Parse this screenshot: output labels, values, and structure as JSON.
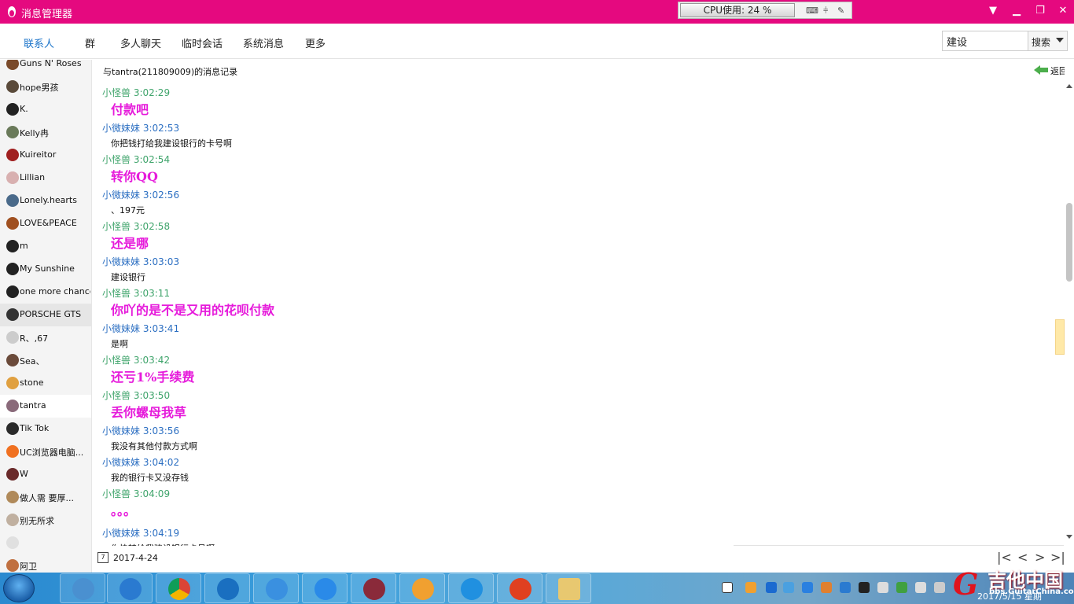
{
  "window": {
    "title": "消息管理器",
    "cpu_usage": "CPU使用: 24 %"
  },
  "tabs": [
    {
      "label": "联系人",
      "active": true
    },
    {
      "label": "群",
      "active": false
    },
    {
      "label": "多人聊天",
      "active": false
    },
    {
      "label": "临时会话",
      "active": false
    },
    {
      "label": "系统消息",
      "active": false
    },
    {
      "label": "更多",
      "active": false
    }
  ],
  "search": {
    "value": "建设",
    "button_label": "搜索"
  },
  "contacts": [
    {
      "name": "Guns N' Roses",
      "avatar_color": "#7a4a2a"
    },
    {
      "name": "hope男孩",
      "avatar_color": "#5a4a3a"
    },
    {
      "name": "K.",
      "avatar_color": "#222222"
    },
    {
      "name": "Kelly冉",
      "avatar_color": "#6a7a5a"
    },
    {
      "name": "Kuireitor",
      "avatar_color": "#a02020"
    },
    {
      "name": "Lillian",
      "avatar_color": "#d8b0b0"
    },
    {
      "name": "Lonely.hearts",
      "avatar_color": "#4a6a8a"
    },
    {
      "name": "LOVE&PEACE",
      "avatar_color": "#a05020"
    },
    {
      "name": "m",
      "avatar_color": "#222222"
    },
    {
      "name": "My  Sunshine",
      "avatar_color": "#222222"
    },
    {
      "name": "one more chance",
      "avatar_color": "#222222"
    },
    {
      "name": "PORSCHE GTS",
      "avatar_color": "#333333"
    },
    {
      "name": "R、,67",
      "avatar_color": "#cccccc"
    },
    {
      "name": "Sea、",
      "avatar_color": "#6a4a3a"
    },
    {
      "name": "stone",
      "avatar_color": "#e0a040"
    },
    {
      "name": "tantra",
      "avatar_color": "#8a6a7a"
    },
    {
      "name": "Tik Tok",
      "avatar_color": "#2a2a2a"
    },
    {
      "name": "UC浏览器电脑...",
      "avatar_color": "#f07020"
    },
    {
      "name": "W",
      "avatar_color": "#6a2a2a"
    },
    {
      "name": "  做人需   要厚...",
      "avatar_color": "#b08a5a"
    },
    {
      "name": "  别无所求",
      "avatar_color": "#c0b0a0"
    },
    {
      "name": "",
      "avatar_color": "#e0e0e0"
    },
    {
      "name": "阿卫",
      "avatar_color": "#c07040"
    }
  ],
  "chat": {
    "header": "与tantra(211809009)的消息记录",
    "back_label": "返回",
    "messages": [
      {
        "sender": "小怪兽",
        "time": "3:02:29",
        "text": "付款吧",
        "side": "me",
        "big": true
      },
      {
        "sender": "小微妹妹",
        "time": "3:02:53",
        "text": "你把钱打给我建设银行的卡号啊",
        "side": "them",
        "big": false
      },
      {
        "sender": "小怪兽",
        "time": "3:02:54",
        "text": "转你QQ",
        "side": "me",
        "big": true
      },
      {
        "sender": "小微妹妹",
        "time": "3:02:56",
        "text": "、197元",
        "side": "them",
        "big": false
      },
      {
        "sender": "小怪兽",
        "time": "3:02:58",
        "text": "还是哪",
        "side": "me",
        "big": true
      },
      {
        "sender": "小微妹妹",
        "time": "3:03:03",
        "text": "建设银行",
        "side": "them",
        "big": false
      },
      {
        "sender": "小怪兽",
        "time": "3:03:11",
        "text": "你吖的是不是又用的花呗付款",
        "side": "me",
        "big": true
      },
      {
        "sender": "小微妹妹",
        "time": "3:03:41",
        "text": "是啊",
        "side": "them",
        "big": false
      },
      {
        "sender": "小怪兽",
        "time": "3:03:42",
        "text": "还亏1%手续费",
        "side": "me",
        "big": true
      },
      {
        "sender": "小怪兽",
        "time": "3:03:50",
        "text": "丢你螺母我草",
        "side": "me",
        "big": true
      },
      {
        "sender": "小微妹妹",
        "time": "3:03:56",
        "text": "我没有其他付款方式啊",
        "side": "them",
        "big": false
      },
      {
        "sender": "小微妹妹",
        "time": "3:04:02",
        "text": "我的银行卡又没存钱",
        "side": "them",
        "big": false
      },
      {
        "sender": "小怪兽",
        "time": "3:04:09",
        "text": "。。。",
        "side": "me",
        "big": true
      },
      {
        "sender": "小微妹妹",
        "time": "3:04:19",
        "text": "你快转给我建设银行卡号啊",
        "side": "them",
        "big": false
      }
    ]
  },
  "footer": {
    "calendar_day": "7",
    "date": "2017-4-24",
    "pager": [
      "|<",
      "<",
      ">",
      ">|"
    ]
  },
  "taskbar": {
    "clock": "2017/5/15 星期",
    "watermark_title": "吉他中国",
    "watermark_url": "bbs.GuitarChina.com",
    "watermark_logo": "G"
  },
  "colors": {
    "titlebar": "#e5097f",
    "tab_active": "#1a73c9",
    "sender_me": "#3fa46b",
    "sender_them": "#2c6fc2",
    "big_text": "#e61bdb"
  }
}
